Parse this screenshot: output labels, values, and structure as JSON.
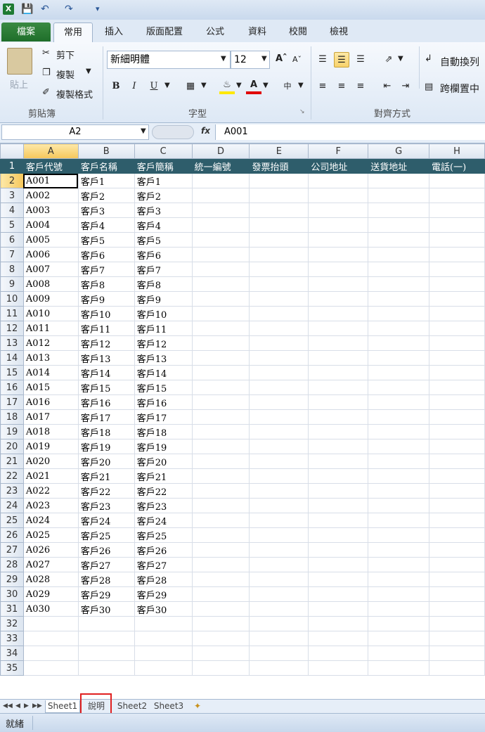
{
  "ribbon_tabs": [
    "檔案",
    "常用",
    "插入",
    "版面配置",
    "公式",
    "資料",
    "校閱",
    "檢視"
  ],
  "clipboard": {
    "paste": "貼上",
    "cut": "剪下",
    "copy": "複製",
    "format_painter": "複製格式",
    "group": "剪貼簿"
  },
  "font": {
    "name": "新細明體",
    "size": "12",
    "group": "字型"
  },
  "alignment": {
    "wrap": "自動換列",
    "merge": "跨欄置中",
    "group": "對齊方式"
  },
  "formula_bar": {
    "name_box": "A2",
    "fx": "fx",
    "value": "A001"
  },
  "columns": [
    "A",
    "B",
    "C",
    "D",
    "E",
    "F",
    "G",
    "H"
  ],
  "header_row": [
    "客戶代號",
    "客戶名稱",
    "客戶簡稱",
    "統一編號",
    "發票抬頭",
    "公司地址",
    "送貨地址",
    "電話(一)"
  ],
  "rows": [
    [
      "A001",
      "客戶1",
      "客戶1"
    ],
    [
      "A002",
      "客戶2",
      "客戶2"
    ],
    [
      "A003",
      "客戶3",
      "客戶3"
    ],
    [
      "A004",
      "客戶4",
      "客戶4"
    ],
    [
      "A005",
      "客戶5",
      "客戶5"
    ],
    [
      "A006",
      "客戶6",
      "客戶6"
    ],
    [
      "A007",
      "客戶7",
      "客戶7"
    ],
    [
      "A008",
      "客戶8",
      "客戶8"
    ],
    [
      "A009",
      "客戶9",
      "客戶9"
    ],
    [
      "A010",
      "客戶10",
      "客戶10"
    ],
    [
      "A011",
      "客戶11",
      "客戶11"
    ],
    [
      "A012",
      "客戶12",
      "客戶12"
    ],
    [
      "A013",
      "客戶13",
      "客戶13"
    ],
    [
      "A014",
      "客戶14",
      "客戶14"
    ],
    [
      "A015",
      "客戶15",
      "客戶15"
    ],
    [
      "A016",
      "客戶16",
      "客戶16"
    ],
    [
      "A017",
      "客戶17",
      "客戶17"
    ],
    [
      "A018",
      "客戶18",
      "客戶18"
    ],
    [
      "A019",
      "客戶19",
      "客戶19"
    ],
    [
      "A020",
      "客戶20",
      "客戶20"
    ],
    [
      "A021",
      "客戶21",
      "客戶21"
    ],
    [
      "A022",
      "客戶22",
      "客戶22"
    ],
    [
      "A023",
      "客戶23",
      "客戶23"
    ],
    [
      "A024",
      "客戶24",
      "客戶24"
    ],
    [
      "A025",
      "客戶25",
      "客戶25"
    ],
    [
      "A026",
      "客戶26",
      "客戶26"
    ],
    [
      "A027",
      "客戶27",
      "客戶27"
    ],
    [
      "A028",
      "客戶28",
      "客戶28"
    ],
    [
      "A029",
      "客戶29",
      "客戶29"
    ],
    [
      "A030",
      "客戶30",
      "客戶30"
    ]
  ],
  "empty_rows": [
    32,
    33,
    34,
    35
  ],
  "sheets": [
    "Sheet1",
    "說明",
    "Sheet2",
    "Sheet3"
  ],
  "status": "就緒",
  "colors": {
    "header_fill": "#2e5d6b",
    "highlight": "#e02020"
  }
}
